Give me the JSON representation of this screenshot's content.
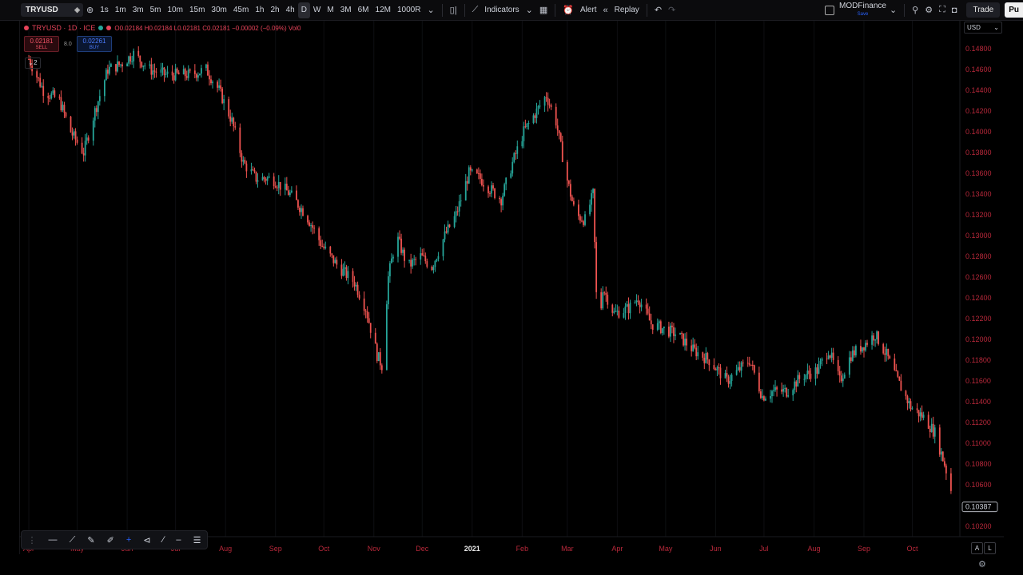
{
  "toolbar": {
    "symbol": "TRYUSD",
    "intervals": [
      "1s",
      "1m",
      "3m",
      "5m",
      "10m",
      "15m",
      "30m",
      "45m",
      "1h",
      "2h",
      "4h",
      "D",
      "W",
      "M",
      "3M",
      "6M",
      "12M",
      "1000R"
    ],
    "active_interval": "D",
    "indicators_label": "Indicators",
    "alert_label": "Alert",
    "replay_label": "Replay",
    "layout_name": "MODFinance",
    "layout_status": "Save",
    "trade_label": "Trade",
    "publish_label": "Pu"
  },
  "legend": {
    "title": "TRYUSD · 1D · ICE",
    "ohlc": "O0.02184 H0.02184 L0.02181 C0.02181 −0.00002 (−0.09%) Vol0",
    "sell_price": "0.02181",
    "sell_label": "SELL",
    "spread": "8.0",
    "buy_price": "0.02261",
    "buy_label": "BUY",
    "collapse_count": "2"
  },
  "price_axis": {
    "currency": "USD"
  },
  "colors": {
    "up": "#26a69a",
    "down": "#ef5350",
    "background": "#000000",
    "axis_text": "#b8283a",
    "last_price_label": "#cfd3dc"
  },
  "chart_data": {
    "type": "candlestick",
    "symbol": "TRYUSD",
    "interval": "1D",
    "exchange": "ICE",
    "y_ticks": [
      0.102,
      0.104,
      0.106,
      0.108,
      0.11,
      0.112,
      0.114,
      0.116,
      0.118,
      0.12,
      0.122,
      0.124,
      0.126,
      0.128,
      0.13,
      0.132,
      0.134,
      0.136,
      0.138,
      0.14,
      0.142,
      0.144,
      0.146,
      0.148
    ],
    "y_tick_labels": [
      "0.10200",
      "0.10400",
      "0.10600",
      "0.10800",
      "0.11000",
      "0.11200",
      "0.11400",
      "0.11600",
      "0.11800",
      "0.12000",
      "0.12200",
      "0.12400",
      "0.12600",
      "0.12800",
      "0.13000",
      "0.13200",
      "0.13400",
      "0.13600",
      "0.13800",
      "0.14000",
      "0.14200",
      "0.14400",
      "0.14600",
      "0.14800"
    ],
    "ylim": [
      0.101,
      0.149
    ],
    "x_labels": [
      "Apr",
      "May",
      "Jun",
      "Jul",
      "Aug",
      "Sep",
      "Oct",
      "Nov",
      "Dec",
      "2021",
      "Feb",
      "Mar",
      "Apr",
      "May",
      "Jun",
      "Jul",
      "Aug",
      "Sep",
      "Oct"
    ],
    "last_price": "0.10387",
    "close_trend": [
      [
        "2020-04-01",
        0.147
      ],
      [
        "2020-04-10",
        0.144
      ],
      [
        "2020-04-20",
        0.143
      ],
      [
        "2020-04-27",
        0.14
      ],
      [
        "2020-05-05",
        0.138
      ],
      [
        "2020-05-12",
        0.142
      ],
      [
        "2020-05-20",
        0.146
      ],
      [
        "2020-05-28",
        0.1465
      ],
      [
        "2020-06-05",
        0.1475
      ],
      [
        "2020-06-15",
        0.146
      ],
      [
        "2020-06-25",
        0.1455
      ],
      [
        "2020-07-10",
        0.1455
      ],
      [
        "2020-07-20",
        0.146
      ],
      [
        "2020-07-28",
        0.144
      ],
      [
        "2020-08-05",
        0.141
      ],
      [
        "2020-08-12",
        0.137
      ],
      [
        "2020-08-20",
        0.1355
      ],
      [
        "2020-08-30",
        0.1355
      ],
      [
        "2020-09-10",
        0.134
      ],
      [
        "2020-09-20",
        0.132
      ],
      [
        "2020-09-30",
        0.129
      ],
      [
        "2020-10-10",
        0.127
      ],
      [
        "2020-10-20",
        0.1255
      ],
      [
        "2020-10-27",
        0.123
      ],
      [
        "2020-11-03",
        0.1185
      ],
      [
        "2020-11-06",
        0.1175
      ],
      [
        "2020-11-10",
        0.126
      ],
      [
        "2020-11-15",
        0.13
      ],
      [
        "2020-11-22",
        0.127
      ],
      [
        "2020-11-30",
        0.128
      ],
      [
        "2020-12-07",
        0.127
      ],
      [
        "2020-12-15",
        0.13
      ],
      [
        "2020-12-22",
        0.132
      ],
      [
        "2020-12-30",
        0.136
      ],
      [
        "2021-01-06",
        0.1355
      ],
      [
        "2021-01-12",
        0.1345
      ],
      [
        "2021-01-19",
        0.1335
      ],
      [
        "2021-01-26",
        0.137
      ],
      [
        "2021-02-02",
        0.14
      ],
      [
        "2021-02-10",
        0.142
      ],
      [
        "2021-02-16",
        0.1435
      ],
      [
        "2021-02-22",
        0.141
      ],
      [
        "2021-02-28",
        0.136
      ],
      [
        "2021-03-06",
        0.132
      ],
      [
        "2021-03-12",
        0.1315
      ],
      [
        "2021-03-17",
        0.134
      ],
      [
        "2021-03-20",
        0.1195
      ],
      [
        "2021-03-23",
        0.125
      ],
      [
        "2021-03-30",
        0.1225
      ],
      [
        "2021-04-08",
        0.123
      ],
      [
        "2021-04-14",
        0.124
      ],
      [
        "2021-04-22",
        0.1215
      ],
      [
        "2021-04-30",
        0.121
      ],
      [
        "2021-05-08",
        0.1205
      ],
      [
        "2021-05-18",
        0.119
      ],
      [
        "2021-05-28",
        0.118
      ],
      [
        "2021-06-08",
        0.116
      ],
      [
        "2021-06-15",
        0.117
      ],
      [
        "2021-06-22",
        0.118
      ],
      [
        "2021-06-30",
        0.1145
      ],
      [
        "2021-07-06",
        0.115
      ],
      [
        "2021-07-15",
        0.115
      ],
      [
        "2021-07-25",
        0.1165
      ],
      [
        "2021-08-03",
        0.117
      ],
      [
        "2021-08-10",
        0.119
      ],
      [
        "2021-08-17",
        0.116
      ],
      [
        "2021-08-24",
        0.1185
      ],
      [
        "2021-09-01",
        0.1195
      ],
      [
        "2021-09-08",
        0.1205
      ],
      [
        "2021-09-15",
        0.1185
      ],
      [
        "2021-09-22",
        0.116
      ],
      [
        "2021-09-30",
        0.1135
      ],
      [
        "2021-10-08",
        0.1125
      ],
      [
        "2021-10-15",
        0.111
      ],
      [
        "2021-10-21",
        0.108
      ],
      [
        "2021-10-25",
        0.1055
      ]
    ]
  }
}
